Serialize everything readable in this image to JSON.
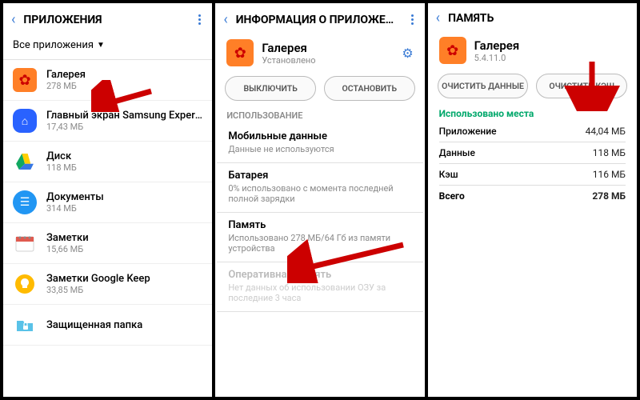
{
  "panel1": {
    "title": "ПРИЛОЖЕНИЯ",
    "filter": "Все приложения",
    "apps": [
      {
        "name": "Галерея",
        "size": "278 МБ"
      },
      {
        "name": "Главный экран Samsung Experie..",
        "size": "17,43 МБ"
      },
      {
        "name": "Диск",
        "size": "118 МБ"
      },
      {
        "name": "Документы",
        "size": "314 МБ"
      },
      {
        "name": "Заметки",
        "size": "15,66 МБ"
      },
      {
        "name": "Заметки Google Keep",
        "size": "33,85 МБ"
      },
      {
        "name": "Защищенная папка",
        "size": ""
      }
    ]
  },
  "panel2": {
    "title": "ИНФОРМАЦИЯ О ПРИЛОЖЕНИИ",
    "app_name": "Галерея",
    "app_status": "Установлено",
    "btn_disable": "ВЫКЛЮЧИТЬ",
    "btn_stop": "ОСТАНОВИТЬ",
    "section_usage": "ИСПОЛЬЗОВАНИЕ",
    "mobile_data_t": "Мобильные данные",
    "mobile_data_d": "Данные не используются",
    "battery_t": "Батарея",
    "battery_d": "0% использовано с момента последней полной зарядки",
    "memory_t": "Память",
    "memory_d": "Использовано 278 МБ/64 Гб из памяти устройства",
    "ram_t": "Оперативная память",
    "ram_d": "Нет данных об использовании ОЗУ за последние 3 часа"
  },
  "panel3": {
    "title": "ПАМЯТЬ",
    "app_name": "Галерея",
    "app_version": "5.4.11.0",
    "btn_clear_data": "ОЧИСТИТЬ ДАННЫЕ",
    "btn_clear_cache": "ОЧИСТИТЬ КЭШ",
    "used_h": "Использовано места",
    "rows": {
      "app_k": "Приложение",
      "app_v": "44,04 МБ",
      "data_k": "Данные",
      "data_v": "118 МБ",
      "cache_k": "Кэш",
      "cache_v": "116 МБ",
      "total_k": "Всего",
      "total_v": "278 МБ"
    }
  }
}
